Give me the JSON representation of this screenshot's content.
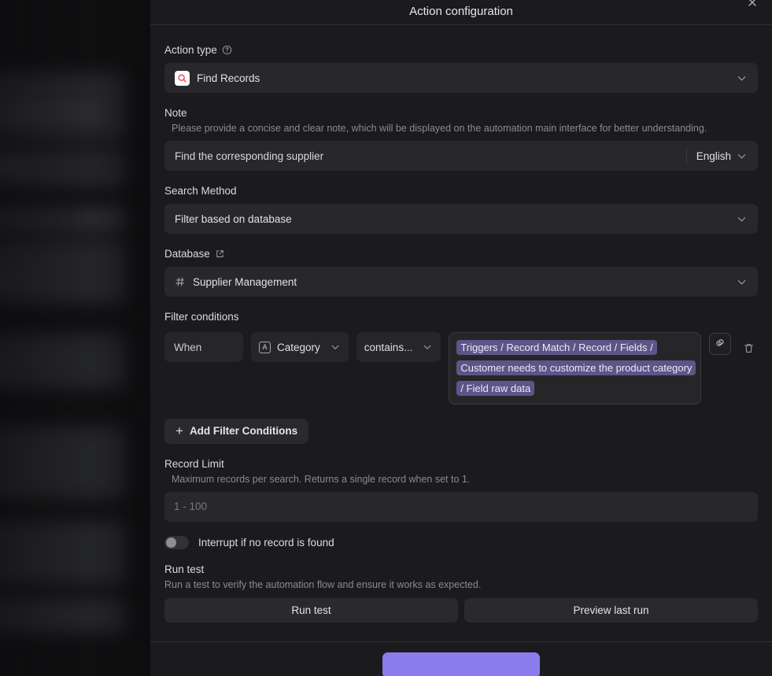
{
  "header": {
    "title": "Action configuration",
    "close_icon": "close-icon"
  },
  "action_type": {
    "label": "Action type",
    "help_icon": "help-circle-icon",
    "value": "Find Records",
    "value_icon": "find-records-icon",
    "chevron_icon": "chevron-down-icon"
  },
  "note": {
    "label": "Note",
    "hint": "Please provide a concise and clear note, which will be displayed on the automation main interface for better understanding.",
    "value": "Find the corresponding supplier",
    "language": "English",
    "chevron_icon": "chevron-down-icon"
  },
  "search_method": {
    "label": "Search Method",
    "value": "Filter based on database",
    "chevron_icon": "chevron-down-icon"
  },
  "database": {
    "label": "Database",
    "external_icon": "external-link-icon",
    "value": "Supplier Management",
    "value_icon": "hash-icon",
    "chevron_icon": "chevron-down-icon"
  },
  "filter_conditions": {
    "label": "Filter conditions",
    "rows": [
      {
        "conjunction": "When",
        "field": "Category",
        "field_type_icon": "text-field-icon",
        "operator": "contains...",
        "value_token": "Triggers / Record Match / Record / Fields / Customer needs to customize the product category / Field raw data",
        "settings_icon": "gear-icon",
        "delete_icon": "trash-icon"
      }
    ],
    "add_label": "Add Filter Conditions",
    "add_icon": "plus-icon"
  },
  "record_limit": {
    "label": "Record Limit",
    "hint": "Maximum records per search. Returns a single record when set to 1.",
    "placeholder": "1 - 100",
    "value": ""
  },
  "interrupt_toggle": {
    "label": "Interrupt if no record is found",
    "state": "off"
  },
  "run_test": {
    "label": "Run test",
    "hint": "Run a test to verify the automation flow and ensure it works as expected.",
    "run_button": "Run test",
    "preview_button": "Preview last run"
  },
  "footer": {
    "primary_button": "",
    "primary_color": "#8b7ced"
  },
  "colors": {
    "panel_bg": "#1b1b1d",
    "control_bg": "#28282b",
    "token_bg": "#5d5589",
    "accent": "#8b7ced"
  }
}
